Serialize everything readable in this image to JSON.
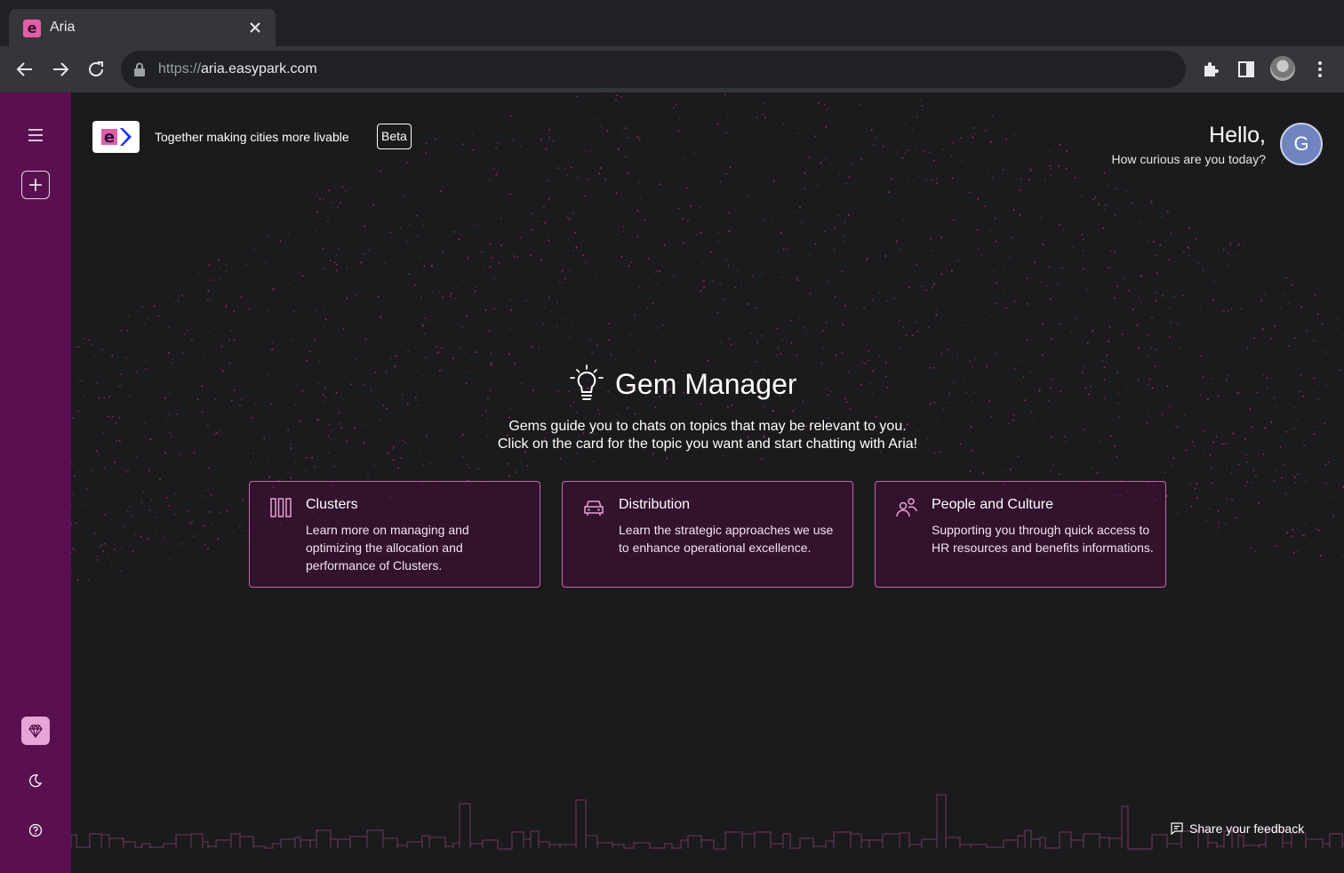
{
  "browser": {
    "tab_title": "Aria",
    "favicon_letter": "e",
    "url_scheme": "https://",
    "url_host": "aria.easypark.com"
  },
  "header": {
    "logo_letter": "e",
    "tagline": "Together making cities more livable",
    "badge": "Beta",
    "greeting": "Hello,",
    "greeting_sub": "How curious are you today?",
    "avatar_initial": "G"
  },
  "sidebar": {
    "items": [
      {
        "name": "menu-icon"
      },
      {
        "name": "new-chat-icon"
      },
      {
        "name": "gem-icon"
      },
      {
        "name": "moon-icon"
      },
      {
        "name": "help-icon"
      }
    ]
  },
  "gem_manager": {
    "title": "Gem Manager",
    "description_line1": "Gems guide you to chats on topics that may be relevant to you.",
    "description_line2": "Click on the card for the topic you want and start chatting with Aria!"
  },
  "cards": [
    {
      "icon": "clusters-icon",
      "title": "Clusters",
      "description": "Learn more on managing and optimizing the allocation and performance of Clusters."
    },
    {
      "icon": "car-icon",
      "title": "Distribution",
      "description": "Learn the strategic approaches we use to enhance operational excellence."
    },
    {
      "icon": "people-icon",
      "title": "People and Culture",
      "description": "Supporting you through quick access to HR resources and benefits informations."
    }
  ],
  "footer": {
    "feedback_label": "Share your feedback"
  },
  "colors": {
    "sidebar": "#5a1050",
    "accent_pink": "#e25ea8",
    "card_border": "#c26aab",
    "background": "#1b1a1c"
  }
}
